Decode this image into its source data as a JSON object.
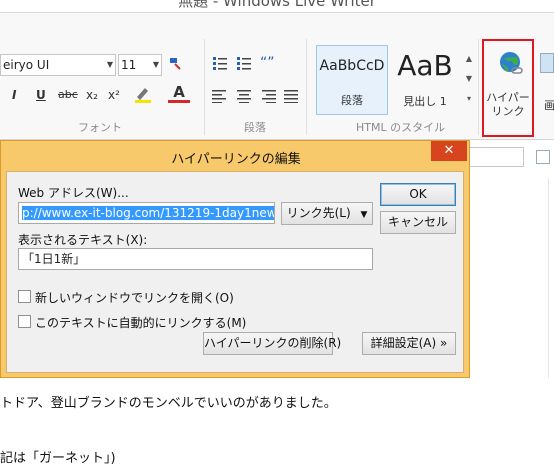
{
  "window": {
    "title": "無題 - Windows Live Writer"
  },
  "ribbon": {
    "font_name": "eiryo UI",
    "font_size": "11",
    "group_font": "フォント",
    "group_paragraph": "段落",
    "group_html_style": "HTML のスタイル",
    "format_buttons": {
      "italic": "I",
      "underline": "U",
      "strike": "abc",
      "subscript": "x₂",
      "superscript": "x²",
      "text_color": "A"
    },
    "styles": [
      {
        "preview": "AaBbCcD",
        "caption": "段落"
      },
      {
        "preview": "AaB",
        "caption": "見出し 1"
      }
    ],
    "hyperlink_label_line1": "ハイパー",
    "hyperlink_label_line2": "リンク",
    "next_group_label": "画"
  },
  "dialog": {
    "title": "ハイパーリンクの編集",
    "close_glyph": "✕",
    "web_address_label": "Web アドレス(W)...",
    "web_address_value": "p://www.ex-it-blog.com/131219-1day1new",
    "link_target_label": "リンク先(L)",
    "display_text_label": "表示されるテキスト(X):",
    "display_text_value": "「1日1新」",
    "checkbox_new_window": {
      "label": "新しいウィンドウでリンクを開く(O)",
      "checked": false
    },
    "checkbox_auto_link": {
      "label": "このテキストに自動的にリンクする(M)",
      "checked": false
    },
    "ok_label": "OK",
    "cancel_label": "キャンセル",
    "remove_link_label": "ハイパーリンクの削除(R)",
    "advanced_label": "詳細設定(A) »"
  },
  "document": {
    "line1": "トドア、登山ブランドのモンベルでいいのがありました。",
    "line2": "記は「ガーネット」)"
  },
  "colors": {
    "accent_red": "#e0171f",
    "dialog_frame": "#f7c96a",
    "selection": "#3399ff"
  },
  "icons": [
    "paste-format-icon",
    "bullets-icon",
    "numbering-icon",
    "quote-icon",
    "align-left-icon",
    "align-center-icon",
    "align-right-icon",
    "justify-icon",
    "highlight-icon",
    "globe-link-icon",
    "close-icon",
    "dropdown-arrow-icon"
  ]
}
